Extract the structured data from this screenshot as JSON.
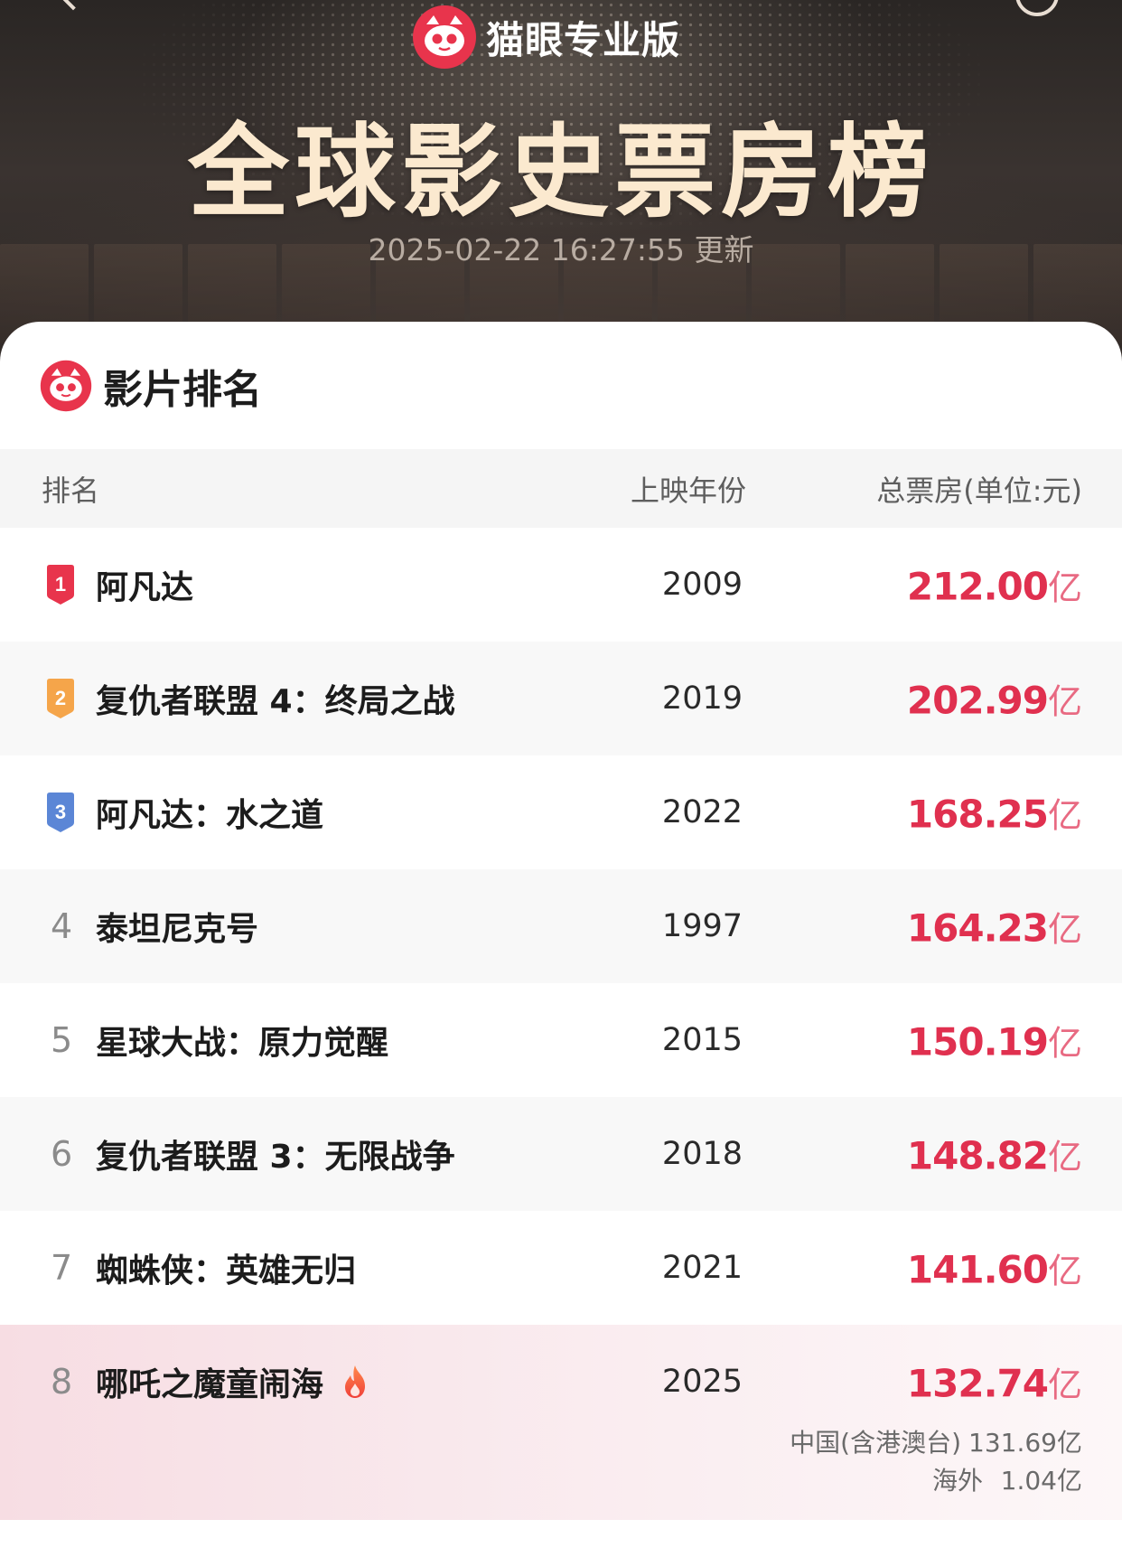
{
  "header": {
    "brand_name": "猫眼专业版",
    "title": "全球影史票房榜",
    "updated": "2025-02-22 16:27:55 更新"
  },
  "section": {
    "title": "影片排名"
  },
  "columns": {
    "rank": "排名",
    "year": "上映年份",
    "gross": "总票房(单位:元)"
  },
  "colors": {
    "accent": "#e0304f",
    "rank1": "#e8344c",
    "rank2": "#f5a54a",
    "rank3": "#5b86d6"
  },
  "movies": [
    {
      "rank": "1",
      "name": "阿凡达",
      "year": "2009",
      "gross": "212.00",
      "unit": "亿"
    },
    {
      "rank": "2",
      "name": "复仇者联盟 4：终局之战",
      "year": "2019",
      "gross": "202.99",
      "unit": "亿"
    },
    {
      "rank": "3",
      "name": "阿凡达：水之道",
      "year": "2022",
      "gross": "168.25",
      "unit": "亿"
    },
    {
      "rank": "4",
      "name": "泰坦尼克号",
      "year": "1997",
      "gross": "164.23",
      "unit": "亿"
    },
    {
      "rank": "5",
      "name": "星球大战：原力觉醒",
      "year": "2015",
      "gross": "150.19",
      "unit": "亿"
    },
    {
      "rank": "6",
      "name": "复仇者联盟 3：无限战争",
      "year": "2018",
      "gross": "148.82",
      "unit": "亿"
    },
    {
      "rank": "7",
      "name": "蜘蛛侠：英雄无归",
      "year": "2021",
      "gross": "141.60",
      "unit": "亿"
    },
    {
      "rank": "8",
      "name": "哪吒之魔童闹海",
      "year": "2025",
      "gross": "132.74",
      "unit": "亿",
      "hot_icon": "fire-icon",
      "breakdown": {
        "china_label": "中国(含港澳台)",
        "china_value": "131.69亿",
        "overseas_label": "海外",
        "overseas_value": "1.04亿"
      }
    }
  ]
}
